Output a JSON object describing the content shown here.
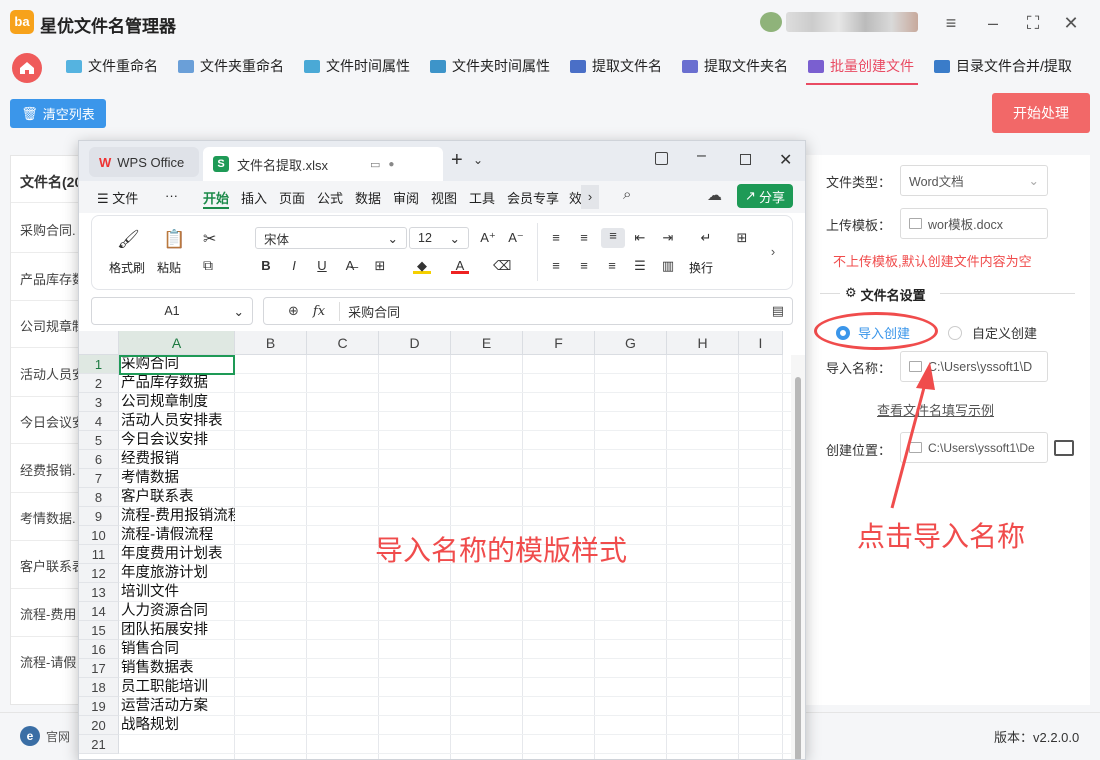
{
  "app": {
    "title": "星优文件名管理器",
    "logo_text": "ba"
  },
  "nav": {
    "items": [
      {
        "label": "文件重命名",
        "color": "#55b3e0"
      },
      {
        "label": "文件夹重命名",
        "color": "#6a9fd8"
      },
      {
        "label": "文件时间属性",
        "color": "#4aa9d6"
      },
      {
        "label": "文件夹时间属性",
        "color": "#3d94c9"
      },
      {
        "label": "提取文件名",
        "color": "#4a6fc7"
      },
      {
        "label": "提取文件夹名",
        "color": "#6a6fd0"
      },
      {
        "label": "批量创建文件",
        "color": "#7a5fd0"
      },
      {
        "label": "目录文件合并/提取",
        "color": "#3a7cc9"
      }
    ],
    "active_index": 6
  },
  "toolbar": {
    "clear_label": "清空列表",
    "start_label": "开始处理"
  },
  "left_list": {
    "header": "文件名(20",
    "rows": [
      "采购合同.",
      "产品库存数",
      "公司规章制",
      "活动人员安",
      "今日会议安",
      "经费报销.",
      "考情数据.",
      "客户联系表",
      "流程-费用",
      "流程-请假"
    ]
  },
  "right_panel": {
    "file_type_label": "文件类型：",
    "file_type_value": "Word文档",
    "upload_label": "上传模板：",
    "upload_value": "wor模板.docx",
    "hint": "不上传模板,默认创建文件内容为空",
    "section_title": "文件名设置",
    "radio_import": "导入创建",
    "radio_custom": "自定义创建",
    "import_label": "导入名称：",
    "import_value": "C:\\Users\\yssoft1\\D",
    "example_link": "查看文件名填写示例",
    "create_label": "创建位置：",
    "create_value": "C:\\Users\\yssoft1\\De"
  },
  "footer": {
    "site_label": "官网",
    "version": "版本：v2.2.0.0"
  },
  "annotation": {
    "click_hint": "点击导入名称",
    "template_hint": "导入名称的模版样式"
  },
  "wps": {
    "tab_app": "WPS Office",
    "tab_file": "文件名提取.xlsx",
    "menu": [
      "文件",
      "开始",
      "插入",
      "页面",
      "公式",
      "数据",
      "审阅",
      "视图",
      "工具",
      "会员专享",
      "效"
    ],
    "active_menu": "开始",
    "share_label": "分享",
    "ribbon": {
      "format_brush": "格式刷",
      "paste": "粘贴",
      "font": "宋体",
      "size": "12",
      "wrap": "换行"
    },
    "name_box": "A1",
    "fx": "fx",
    "formula_value": "采购合同",
    "columns": [
      "A",
      "B",
      "C",
      "D",
      "E",
      "F",
      "G",
      "H",
      "I"
    ],
    "rows": [
      "采购合同",
      "产品库存数据",
      "公司规章制度",
      "活动人员安排表",
      "今日会议安排",
      "经费报销",
      "考情数据",
      "客户联系表",
      "流程-费用报销流程",
      "流程-请假流程",
      "年度费用计划表",
      "年度旅游计划",
      "培训文件",
      "人力资源合同",
      "团队拓展安排",
      "销售合同",
      "销售数据表",
      "员工职能培训",
      "运营活动方案",
      "战略规划",
      ""
    ],
    "row_numbers": [
      "1",
      "2",
      "3",
      "4",
      "5",
      "6",
      "7",
      "8",
      "9",
      "10",
      "11",
      "12",
      "13",
      "14",
      "15",
      "16",
      "17",
      "18",
      "19",
      "20",
      "21"
    ]
  },
  "colors": {
    "accent_red": "#e94b63",
    "primary_blue": "#3b96ea",
    "wps_green": "#1e9a56"
  }
}
